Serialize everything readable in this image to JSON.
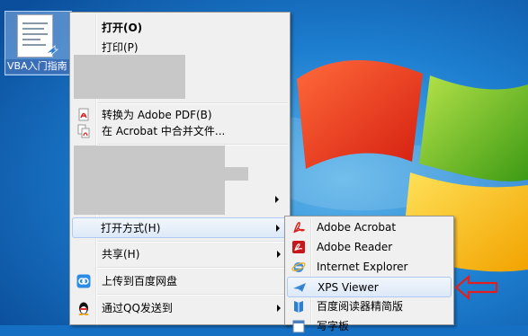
{
  "desktop_icon": {
    "label": "VBA入门指南"
  },
  "context_menu": {
    "open": "打开(O)",
    "print": "打印(P)",
    "convert_pdf": "转换为 Adobe PDF(B)",
    "combine_acrobat": "在 Acrobat 中合并文件...",
    "open_with": "打开方式(H)",
    "share": "共享(H)",
    "upload_baidu": "上传到百度网盘",
    "send_qq": "通过QQ发送到"
  },
  "open_with_submenu": {
    "items": [
      {
        "label": "Adobe Acrobat",
        "icon": "adobe-acrobat-icon"
      },
      {
        "label": "Adobe Reader",
        "icon": "adobe-reader-icon"
      },
      {
        "label": "Internet Explorer",
        "icon": "internet-explorer-icon"
      },
      {
        "label": "XPS Viewer",
        "icon": "xps-viewer-icon"
      },
      {
        "label": "百度阅读器精简版",
        "icon": "baidu-reader-icon"
      },
      {
        "label": "写字板",
        "icon": "wordpad-icon"
      }
    ]
  },
  "colors": {
    "desktop_blue": "#1570c4",
    "menu_bg": "#f0f0f0",
    "highlight_border": "#aecaf0",
    "annotation_red": "#e02020"
  }
}
